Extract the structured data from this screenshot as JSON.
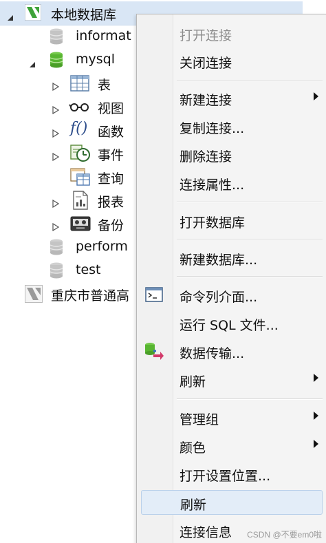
{
  "tree": {
    "root_label": "本地数据库",
    "items": [
      {
        "label": "informat"
      },
      {
        "label": "mysql"
      },
      {
        "label": "表"
      },
      {
        "label": "视图"
      },
      {
        "label": "函数"
      },
      {
        "label": "事件"
      },
      {
        "label": "查询"
      },
      {
        "label": "报表"
      },
      {
        "label": "备份"
      },
      {
        "label": "perform"
      },
      {
        "label": "test"
      }
    ],
    "second_connection_label": "重庆市普通高"
  },
  "context_menu": {
    "items": [
      {
        "label": "打开连接",
        "disabled": true
      },
      {
        "label": "关闭连接"
      },
      {
        "label": "新建连接",
        "submenu": true
      },
      {
        "label": "复制连接..."
      },
      {
        "label": "删除连接"
      },
      {
        "label": "连接属性..."
      },
      {
        "label": "打开数据库"
      },
      {
        "label": "新建数据库..."
      },
      {
        "label": "命令列介面..."
      },
      {
        "label": "运行 SQL 文件..."
      },
      {
        "label": "数据传输..."
      },
      {
        "label": "刷新",
        "submenu": true
      },
      {
        "label": "管理组",
        "submenu": true
      },
      {
        "label": "颜色",
        "submenu": true
      },
      {
        "label": "打开设置位置..."
      },
      {
        "label": "刷新",
        "highlighted": true
      },
      {
        "label": "连接信息"
      }
    ]
  },
  "watermark": "CSDN @不要em0啦",
  "colors": {
    "selection": "#d9e6f5",
    "menu_bg": "#f4f4f4",
    "db_green": "#58b531",
    "hover": "#e3edf8"
  },
  "icons": {
    "connection": "mysql-connection-icon",
    "database": "database-cylinder-icon",
    "table": "table-grid-icon",
    "view": "glasses-view-icon",
    "function": "function-fx-icon",
    "event": "event-clock-icon",
    "query": "query-table-icon",
    "report": "report-page-icon",
    "backup": "backup-tape-icon",
    "cli": "console-icon",
    "transfer": "data-transfer-icon"
  }
}
